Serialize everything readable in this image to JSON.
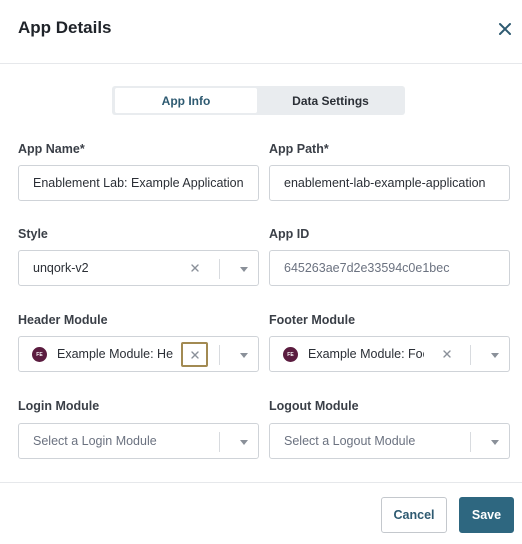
{
  "dialog": {
    "title": "App Details"
  },
  "tabs": [
    {
      "label": "App Info",
      "active": true
    },
    {
      "label": "Data Settings",
      "active": false
    }
  ],
  "fields": {
    "app_name": {
      "label": "App Name*",
      "value": "Enablement Lab: Example Application"
    },
    "app_path": {
      "label": "App Path*",
      "value": "enablement-lab-example-application"
    },
    "style": {
      "label": "Style",
      "value": "unqork-v2"
    },
    "app_id": {
      "label": "App ID",
      "value": "645263ae7d2e33594c0e1bec"
    },
    "header_module": {
      "label": "Header Module",
      "value": "Example Module: Hea",
      "badge": "FE"
    },
    "footer_module": {
      "label": "Footer Module",
      "value": "Example Module: Foo",
      "badge": "FE"
    },
    "login_module": {
      "label": "Login Module",
      "placeholder": "Select a Login Module"
    },
    "logout_module": {
      "label": "Logout Module",
      "placeholder": "Select a Logout Module"
    }
  },
  "buttons": {
    "cancel": "Cancel",
    "save": "Save"
  },
  "colors": {
    "accent": "#2e6780",
    "badge": "#5b1c3f",
    "focus_ring": "#a28a52"
  }
}
